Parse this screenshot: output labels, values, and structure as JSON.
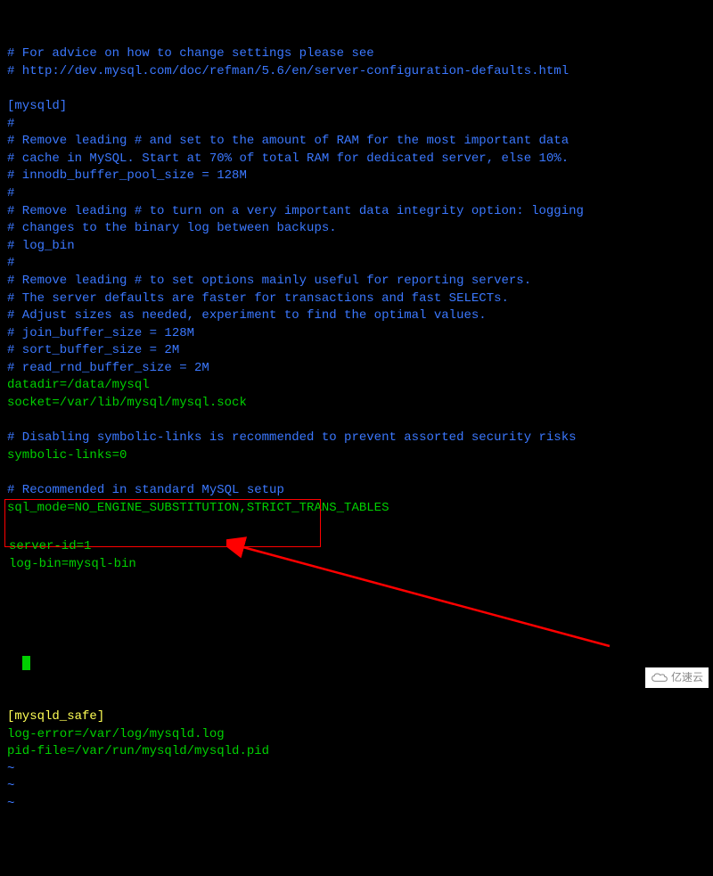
{
  "lines": [
    {
      "cls": "comment",
      "text": "# For advice on how to change settings please see"
    },
    {
      "cls": "comment",
      "text": "# http://dev.mysql.com/doc/refman/5.6/en/server-configuration-defaults.html"
    },
    {
      "cls": "comment",
      "text": ""
    },
    {
      "cls": "comment",
      "text": "[mysqld]"
    },
    {
      "cls": "comment",
      "text": "#"
    },
    {
      "cls": "comment",
      "text": "# Remove leading # and set to the amount of RAM for the most important data"
    },
    {
      "cls": "comment",
      "text": "# cache in MySQL. Start at 70% of total RAM for dedicated server, else 10%."
    },
    {
      "cls": "comment",
      "text": "# innodb_buffer_pool_size = 128M"
    },
    {
      "cls": "comment",
      "text": "#"
    },
    {
      "cls": "comment",
      "text": "# Remove leading # to turn on a very important data integrity option: logging"
    },
    {
      "cls": "comment",
      "text": "# changes to the binary log between backups."
    },
    {
      "cls": "comment",
      "text": "# log_bin"
    },
    {
      "cls": "comment",
      "text": "#"
    },
    {
      "cls": "comment",
      "text": "# Remove leading # to set options mainly useful for reporting servers."
    },
    {
      "cls": "comment",
      "text": "# The server defaults are faster for transactions and fast SELECTs."
    },
    {
      "cls": "comment",
      "text": "# Adjust sizes as needed, experiment to find the optimal values."
    },
    {
      "cls": "comment",
      "text": "# join_buffer_size = 128M"
    },
    {
      "cls": "comment",
      "text": "# sort_buffer_size = 2M"
    },
    {
      "cls": "comment",
      "text": "# read_rnd_buffer_size = 2M"
    },
    {
      "cls": "active",
      "text": "datadir=/data/mysql"
    },
    {
      "cls": "active",
      "text": "socket=/var/lib/mysql/mysql.sock"
    },
    {
      "cls": "comment",
      "text": ""
    },
    {
      "cls": "comment",
      "text": "# Disabling symbolic-links is recommended to prevent assorted security risks"
    },
    {
      "cls": "active",
      "text": "symbolic-links=0"
    },
    {
      "cls": "comment",
      "text": ""
    },
    {
      "cls": "comment",
      "text": "# Recommended in standard MySQL setup"
    },
    {
      "cls": "active",
      "text": "sql_mode=NO_ENGINE_SUBSTITUTION,STRICT_TRANS_TABLES"
    },
    {
      "cls": "active",
      "text": ""
    }
  ],
  "boxed_lines": [
    {
      "cls": "active",
      "text": "server-id=1"
    },
    {
      "cls": "active",
      "text": "log-bin=mysql-bin"
    }
  ],
  "after_lines": [
    {
      "cls": "active",
      "text": ""
    },
    {
      "cls": "yellow",
      "text": "[mysqld_safe]"
    },
    {
      "cls": "active",
      "text": "log-error=/var/log/mysqld.log"
    },
    {
      "cls": "active",
      "text": "pid-file=/var/run/mysqld/mysqld.pid"
    },
    {
      "cls": "tilde",
      "text": "~"
    },
    {
      "cls": "tilde",
      "text": "~"
    },
    {
      "cls": "tilde",
      "text": "~"
    }
  ],
  "watermark_text": "亿速云"
}
